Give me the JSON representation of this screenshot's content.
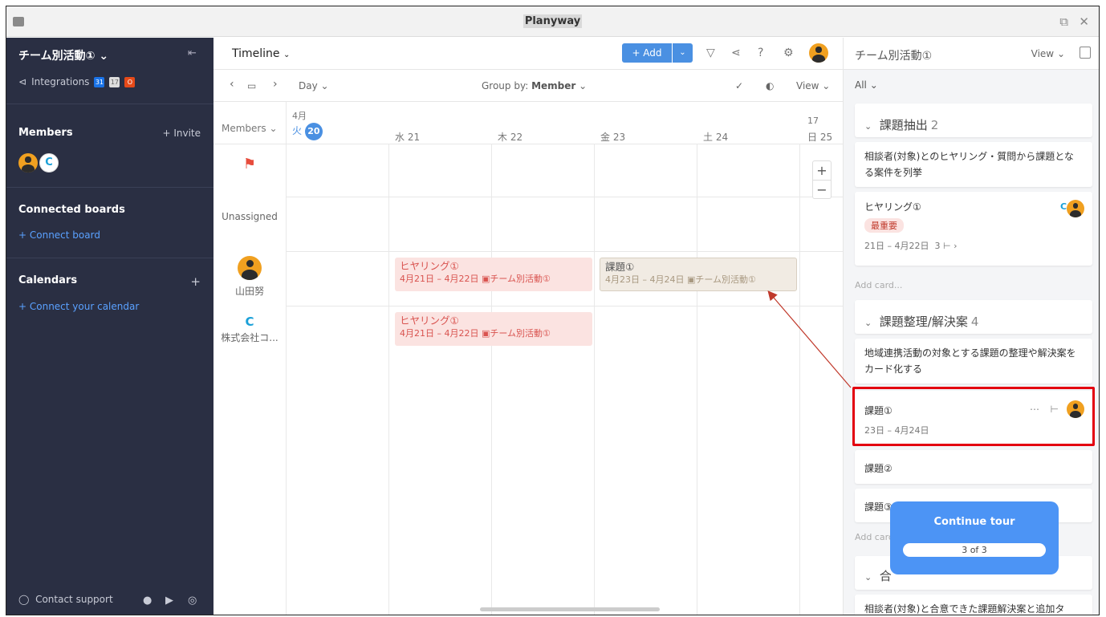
{
  "window": {
    "title": "Planyway"
  },
  "sidebar": {
    "board_name": "チーム別活動①",
    "integrations_label": "Integrations",
    "members_label": "Members",
    "invite_label": "+ Invite",
    "connected_boards_label": "Connected boards",
    "connect_board_label": "+ Connect board",
    "calendars_label": "Calendars",
    "calendars_add": "+",
    "connect_calendar_label": "+ Connect your calendar",
    "contact_support_label": "Contact support"
  },
  "toolbar": {
    "view_name": "Timeline",
    "add_label": "+ Add",
    "scale_label": "Day",
    "group_by_label": "Group by:",
    "group_by_value": "Member",
    "view_label": "View"
  },
  "timeline": {
    "members_header": "Members",
    "month_label": "4月",
    "month_label_2": "17",
    "days": [
      {
        "dow": "火",
        "num": "20",
        "today": true
      },
      {
        "label": "水 21"
      },
      {
        "label": "木 22"
      },
      {
        "label": "金 23"
      },
      {
        "label": "土 24"
      },
      {
        "label": "日 25"
      }
    ],
    "rows": [
      {
        "label": "Unassigned"
      },
      {
        "label": "山田努"
      },
      {
        "label": "株式会社コ..."
      }
    ],
    "events": [
      {
        "title": "ヒヤリング①",
        "date": "4月21日 – 4月22日",
        "board": "チーム別活動①"
      },
      {
        "title": "課題①",
        "date": "4月23日 – 4月24日",
        "board": "チーム別活動①"
      },
      {
        "title": "ヒヤリング①",
        "date": "4月21日 – 4月22日",
        "board": "チーム別活動①"
      }
    ]
  },
  "panel": {
    "title": "チーム別活動①",
    "view_label": "View",
    "filter_label": "All",
    "add_card_label": "Add card...",
    "add_card_label_2": "Add card",
    "groups": [
      {
        "name": "課題抽出",
        "count": "2",
        "description": "相談者(対象)とのヒヤリング・質問から課題となる案件を列挙",
        "cards": [
          {
            "title": "ヒヤリング①",
            "badge": "最重要",
            "dates": "21日 – 4月22日",
            "subtasks": "3"
          }
        ]
      },
      {
        "name": "課題整理/解決案",
        "count": "4",
        "description": "地域連携活動の対象とする課題の整理や解決案をカード化する",
        "cards": [
          {
            "title": "課題①",
            "dates": "23日 – 4月24日"
          },
          {
            "title": "課題②"
          },
          {
            "title": "課題③"
          }
        ]
      },
      {
        "name": "合",
        "description": "相談者(対象)と合意できた課題解決案と追加タ"
      }
    ]
  },
  "tour": {
    "button_label": "Continue tour",
    "progress": "3 of 3",
    "progress_fraction": 1.0
  },
  "colors": {
    "sidebar_bg": "#2a2f43",
    "accent": "#4a90e2",
    "event_pink": "#fbe3e1",
    "highlight": "#e3000f",
    "tour_bg": "#4c94f5"
  }
}
